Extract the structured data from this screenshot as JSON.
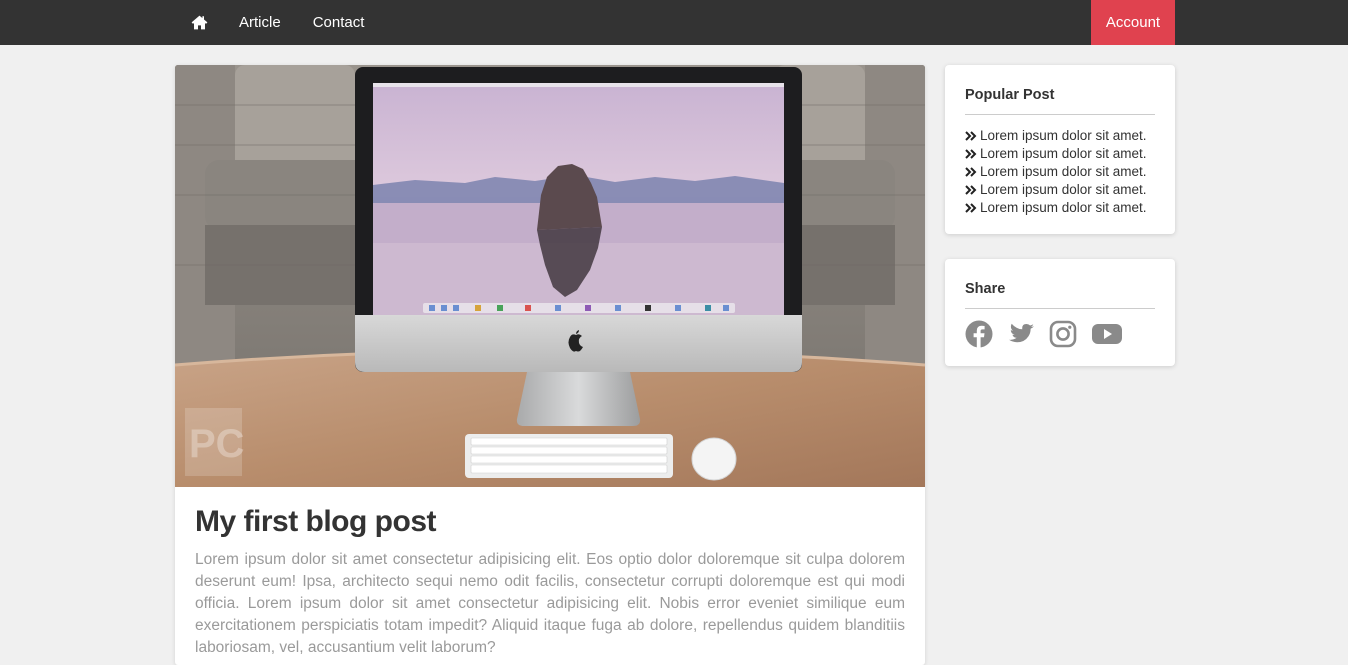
{
  "nav": {
    "home_icon": "home-icon",
    "links": [
      "Article",
      "Contact"
    ],
    "account": "Account",
    "colors": {
      "bar": "#333333",
      "account": "#e0424f"
    }
  },
  "post": {
    "image": "desk-imac-photo",
    "title": "My first blog post",
    "body": "Lorem ipsum dolor sit amet consectetur adipisicing elit. Eos optio dolor doloremque sit culpa dolorem deserunt eum! Ipsa, architecto sequi nemo odit facilis, consectetur corrupti doloremque est qui modi officia. Lorem ipsum dolor sit amet consectetur adipisicing elit. Nobis error eveniet similique eum exercitationem perspiciatis totam impedit? Aliquid itaque fuga ab dolore, repellendus quidem blanditiis laboriosam, vel, accusantium velit laborum?"
  },
  "popular": {
    "title": "Popular Post",
    "items": [
      "Lorem ipsum dolor sit amet.",
      "Lorem ipsum dolor sit amet.",
      "Lorem ipsum dolor sit amet.",
      "Lorem ipsum dolor sit amet.",
      "Lorem ipsum dolor sit amet."
    ]
  },
  "share": {
    "title": "Share",
    "icons": [
      "facebook-icon",
      "twitter-icon",
      "instagram-icon",
      "youtube-icon"
    ],
    "icon_color": "#8a8a8a"
  }
}
